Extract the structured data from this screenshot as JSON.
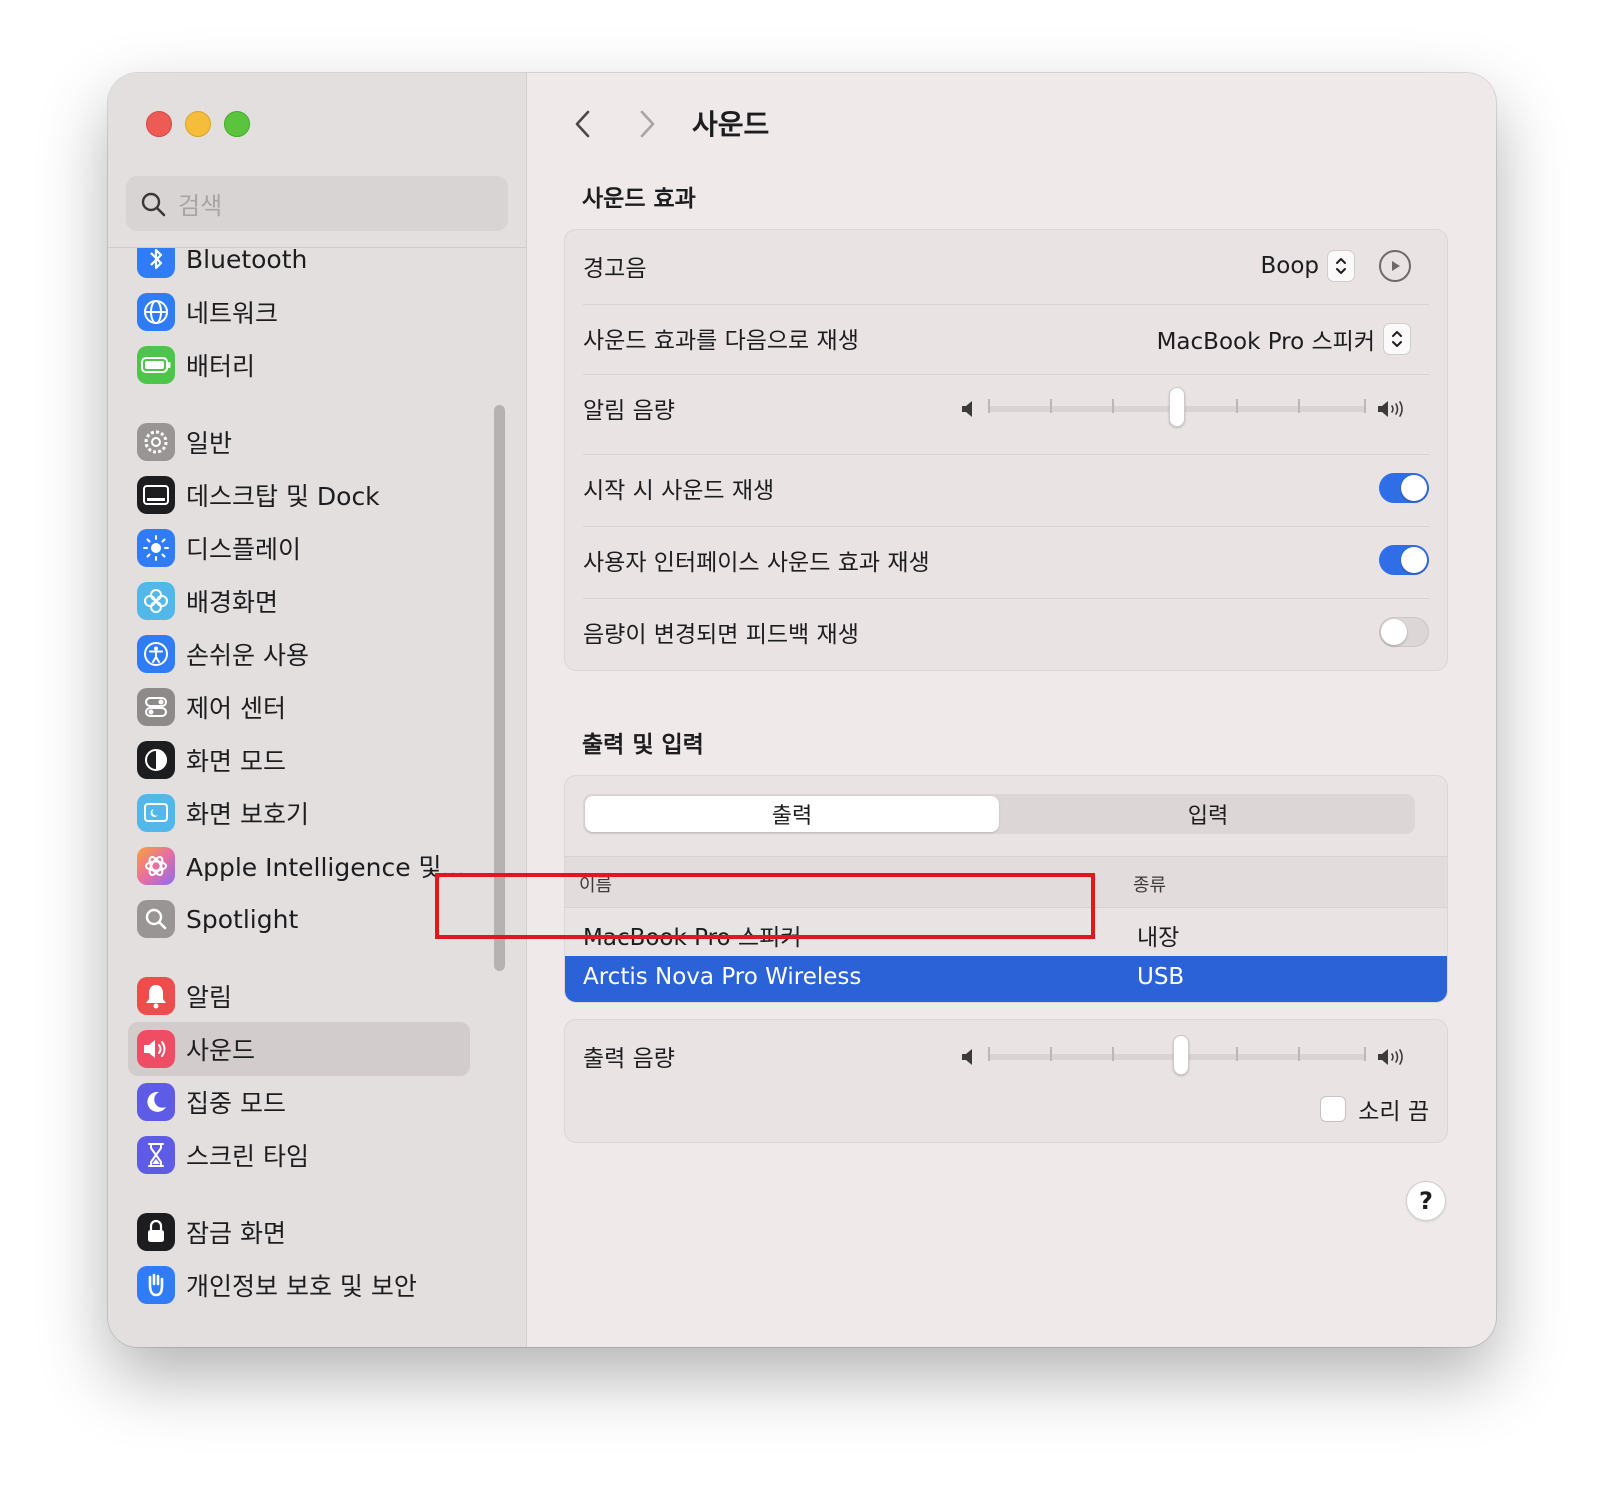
{
  "window": {
    "title": "사운드"
  },
  "sidebar": {
    "search_placeholder": "검색",
    "items": [
      {
        "label": "Bluetooth",
        "icon": "bluetooth-icon",
        "color": "#2f7cf6"
      },
      {
        "label": "네트워크",
        "icon": "globe-icon",
        "color": "#2f7cf6"
      },
      {
        "label": "배터리",
        "icon": "battery-icon",
        "color": "#4cc54a"
      },
      {
        "label": "일반",
        "icon": "gear-icon",
        "color": "#9a9595"
      },
      {
        "label": "데스크탑 및 Dock",
        "icon": "dock-icon",
        "color": "#1d1d1f"
      },
      {
        "label": "디스플레이",
        "icon": "sun-icon",
        "color": "#2f7cf6"
      },
      {
        "label": "배경화면",
        "icon": "flower-icon",
        "color": "#52b8ea"
      },
      {
        "label": "손쉬운 사용",
        "icon": "accessibility-icon",
        "color": "#2f7cf6"
      },
      {
        "label": "제어 센터",
        "icon": "toggles-icon",
        "color": "#8e8a8a"
      },
      {
        "label": "화면 모드",
        "icon": "appearance-icon",
        "color": "#1d1d1f"
      },
      {
        "label": "화면 보호기",
        "icon": "screensaver-icon",
        "color": "#52b8ea"
      },
      {
        "label": "Apple Intelligence 및...",
        "icon": "apple-intelligence-icon",
        "color": "#e86fa0"
      },
      {
        "label": "Spotlight",
        "icon": "magnifier-icon",
        "color": "#9a9595"
      },
      {
        "label": "알림",
        "icon": "bell-icon",
        "color": "#ee4d4d"
      },
      {
        "label": "사운드",
        "icon": "speaker-icon",
        "color": "#ee4d63"
      },
      {
        "label": "집중 모드",
        "icon": "moon-icon",
        "color": "#5e5ce6"
      },
      {
        "label": "스크린 타임",
        "icon": "hourglass-icon",
        "color": "#5e5ce6"
      },
      {
        "label": "잠금 화면",
        "icon": "lock-icon",
        "color": "#1d1d1f"
      },
      {
        "label": "개인정보 보호 및 보안",
        "icon": "hand-icon",
        "color": "#2f7cf6"
      }
    ],
    "selected": "사운드"
  },
  "sound_effects": {
    "section_title": "사운드 효과",
    "alert_sound_label": "경고음",
    "alert_sound_value": "Boop",
    "play_through_label": "사운드 효과를 다음으로 재생",
    "play_through_value": "MacBook Pro 스피커",
    "alert_volume_label": "알림 음량",
    "alert_volume_level": 0.5,
    "startup_sound_label": "시작 시 사운드 재생",
    "startup_sound_on": true,
    "ui_sound_label": "사용자 인터페이스 사운드 효과 재생",
    "ui_sound_on": true,
    "feedback_label": "음량이 변경되면 피드백 재생",
    "feedback_on": false
  },
  "output_input": {
    "section_title": "출력 및 입력",
    "tabs": [
      "출력",
      "입력"
    ],
    "active_tab": "출력",
    "columns": {
      "name": "이름",
      "type": "종류"
    },
    "devices": [
      {
        "name": "MacBook Pro 스피커",
        "type": "내장",
        "selected": false
      },
      {
        "name": "Arctis Nova Pro Wireless",
        "type": "USB",
        "selected": true
      }
    ],
    "output_volume_label": "출력 음량",
    "output_volume_level": 0.51,
    "mute_label": "소리 끔",
    "muted": false
  },
  "help_label": "?",
  "colors": {
    "accent": "#2f6ee6",
    "selection": "#2b62d8",
    "annotation": "#e3151d"
  }
}
